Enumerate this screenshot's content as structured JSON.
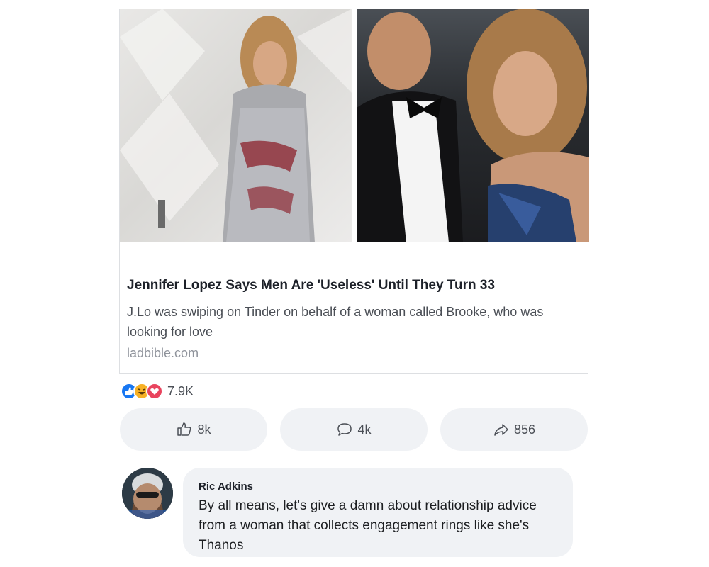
{
  "link_preview": {
    "title": "Jennifer Lopez Says Men Are 'Useless' Until They Turn 33",
    "description": "J.Lo was swiping on Tinder on behalf of a woman called Brooke, who was looking for love",
    "domain": "ladbible.com"
  },
  "reactions": {
    "icons": [
      "like-icon",
      "haha-icon",
      "love-icon"
    ],
    "count": "7.9K"
  },
  "actions": {
    "like_count": "8k",
    "comment_count": "4k",
    "share_count": "856"
  },
  "comment": {
    "author": "Ric Adkins",
    "text": "By all means,  let's give a damn about relationship advice from a woman that collects engagement rings like she's Thanos"
  },
  "colors": {
    "like_blue": "#1877f2",
    "haha_yellow": "#f7b125",
    "love_red": "#e9445e",
    "button_bg": "#f0f2f5"
  }
}
